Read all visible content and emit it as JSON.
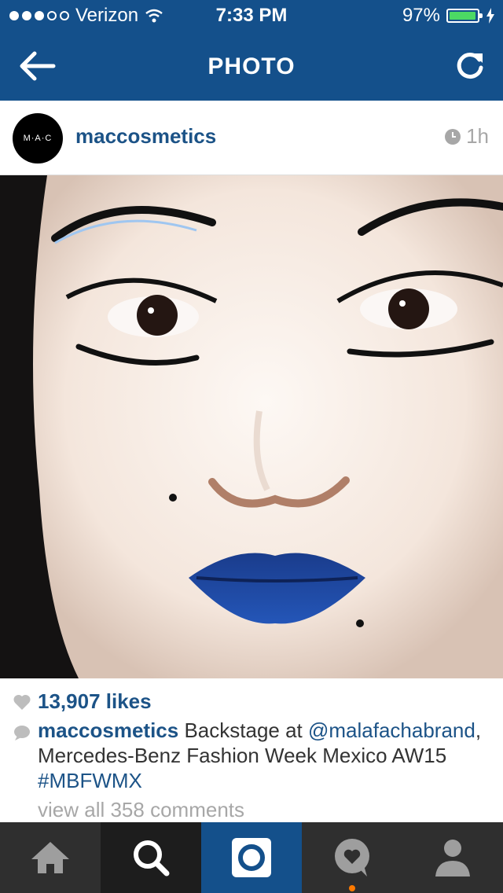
{
  "status_bar": {
    "carrier": "Verizon",
    "time": "7:33 PM",
    "battery_pct": "97%",
    "battery_level": 0.97,
    "signal_bars": 3,
    "signal_max": 5
  },
  "nav": {
    "title": "PHOTO",
    "back_icon": "arrow-left-icon",
    "refresh_icon": "refresh-icon"
  },
  "post": {
    "username": "maccosmetics",
    "avatar_text": "M·A·C",
    "time_ago": "1h",
    "photo_description_icon": "portrait-photo"
  },
  "engagement": {
    "likes": "13,907 likes",
    "caption_user": "maccosmetics",
    "caption_text_1": " Backstage at ",
    "caption_mention": "@malafachabrand",
    "caption_text_2": ", Mercedes-Benz Fashion Week Mexico AW15 ",
    "caption_hashtag": "#MBFWMX",
    "view_comments": "view all 358 comments"
  },
  "tabbar": {
    "items": [
      {
        "name": "home",
        "icon": "home-icon"
      },
      {
        "name": "search",
        "icon": "search-icon"
      },
      {
        "name": "camera",
        "icon": "camera-icon"
      },
      {
        "name": "activity",
        "icon": "heart-bubble-icon"
      },
      {
        "name": "profile",
        "icon": "person-icon"
      }
    ]
  },
  "colors": {
    "header": "#14508b",
    "link": "#1c5387",
    "tabbar": "#2f2f2f",
    "battery": "#4cd964",
    "notification": "#ff7a00"
  }
}
